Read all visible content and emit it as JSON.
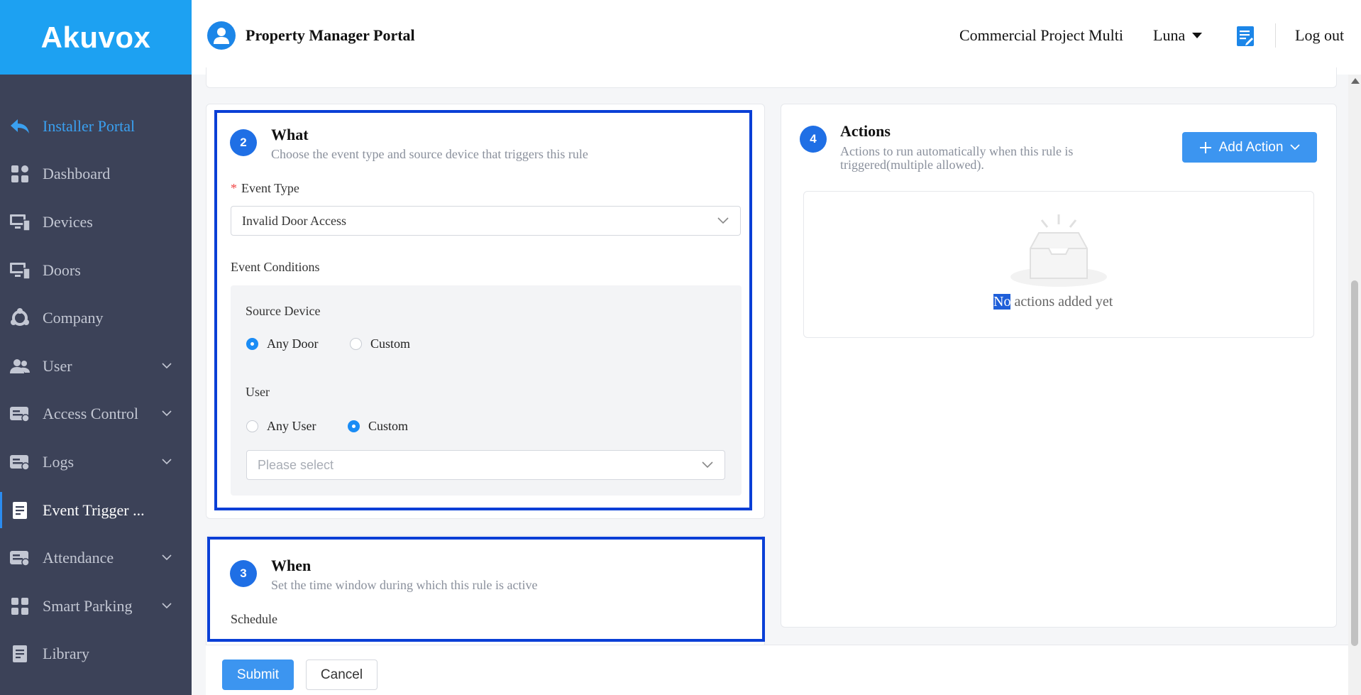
{
  "brand": {
    "logo": "Akuvox",
    "color": "#1da1f2"
  },
  "header": {
    "portal_title": "Property Manager Portal",
    "project": "Commercial Project Multi",
    "user": "Luna",
    "logout": "Log out"
  },
  "sidebar": {
    "items": [
      {
        "label": "Installer Portal",
        "icon": "back-arrow-icon"
      },
      {
        "label": "Dashboard",
        "icon": "grid-icon"
      },
      {
        "label": "Devices",
        "icon": "monitor-icon"
      },
      {
        "label": "Doors",
        "icon": "monitor-icon"
      },
      {
        "label": "Company",
        "icon": "network-icon"
      },
      {
        "label": "User",
        "icon": "users-icon"
      },
      {
        "label": "Access Control",
        "icon": "card-icon"
      },
      {
        "label": "Logs",
        "icon": "card-icon"
      },
      {
        "label": "Event Trigger ...",
        "icon": "document-icon"
      },
      {
        "label": "Attendance",
        "icon": "card-icon"
      },
      {
        "label": "Smart Parking",
        "icon": "grid-icon"
      },
      {
        "label": "Library",
        "icon": "document-icon"
      }
    ]
  },
  "what": {
    "step": "2",
    "title": "What",
    "subtitle": "Choose the event type and source device that triggers this rule",
    "event_type_label": "Event Type",
    "event_type_value": "Invalid Door Access",
    "conditions_label": "Event Conditions",
    "source_device_label": "Source Device",
    "source_options": [
      "Any Door",
      "Custom"
    ],
    "source_selected": "Any Door",
    "user_label": "User",
    "user_options": [
      "Any User",
      "Custom"
    ],
    "user_selected": "Custom",
    "user_select_placeholder": "Please select"
  },
  "when": {
    "step": "3",
    "title": "When",
    "subtitle": "Set the time window during which this rule is active",
    "schedule_label": "Schedule"
  },
  "actions": {
    "step": "4",
    "title": "Actions",
    "subtitle_line1": "Actions to run automatically when this rule is",
    "subtitle_line2": "triggered(multiple allowed).",
    "add_button": "Add Action",
    "empty_highlight": "No",
    "empty_rest": " actions added yet"
  },
  "footer": {
    "submit": "Submit",
    "cancel": "Cancel"
  },
  "colors": {
    "primary": "#3c95f0",
    "step": "#1f6fe5",
    "sidebar": "#3c4258",
    "highlight_border": "#0a3fd6"
  }
}
